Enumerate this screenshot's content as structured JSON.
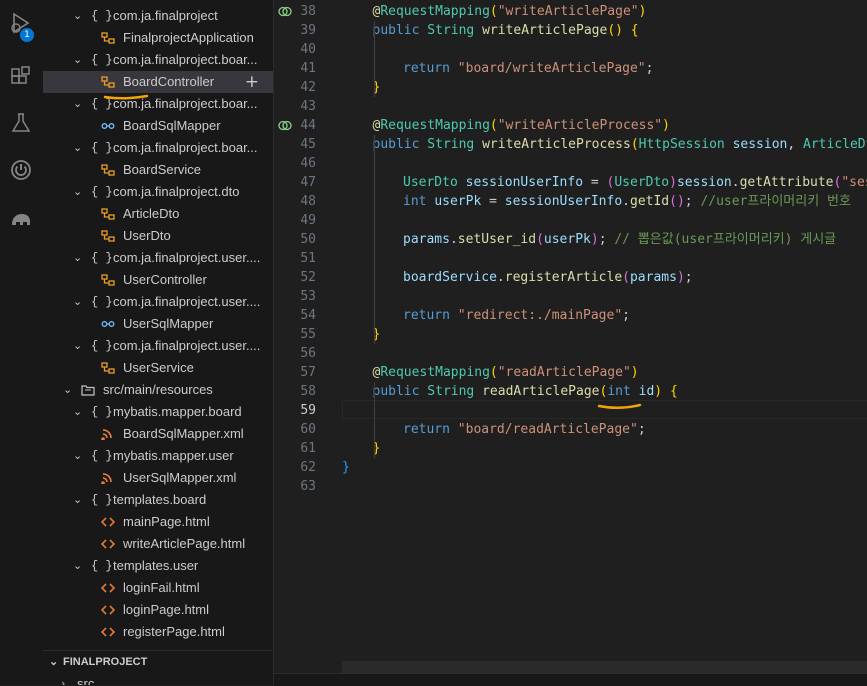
{
  "activity_bar": {
    "icons": [
      "run-debug-icon",
      "extensions-icon",
      "testing-icon",
      "spring-boot-icon",
      "gradle-elephant-icon"
    ],
    "debug_badge": "1"
  },
  "explorer": {
    "rows": [
      {
        "label": "com.ja.finalproject",
        "type": "package",
        "indent": 1
      },
      {
        "label": "FinalprojectApplication",
        "type": "class",
        "indent": 2
      },
      {
        "label": "com.ja.finalproject.boar...",
        "type": "package",
        "indent": 1
      },
      {
        "label": "BoardController",
        "type": "class",
        "indent": 2,
        "selected": true
      },
      {
        "label": "com.ja.finalproject.boar...",
        "type": "package",
        "indent": 1
      },
      {
        "label": "BoardSqlMapper",
        "type": "interface",
        "indent": 2
      },
      {
        "label": "com.ja.finalproject.boar...",
        "type": "package",
        "indent": 1
      },
      {
        "label": "BoardService",
        "type": "class",
        "indent": 2
      },
      {
        "label": "com.ja.finalproject.dto",
        "type": "package",
        "indent": 1
      },
      {
        "label": "ArticleDto",
        "type": "class",
        "indent": 2
      },
      {
        "label": "UserDto",
        "type": "class",
        "indent": 2
      },
      {
        "label": "com.ja.finalproject.user....",
        "type": "package",
        "indent": 1
      },
      {
        "label": "UserController",
        "type": "class",
        "indent": 2
      },
      {
        "label": "com.ja.finalproject.user....",
        "type": "package",
        "indent": 1
      },
      {
        "label": "UserSqlMapper",
        "type": "interface",
        "indent": 2
      },
      {
        "label": "com.ja.finalproject.user....",
        "type": "package",
        "indent": 1
      },
      {
        "label": "UserService",
        "type": "class",
        "indent": 2
      },
      {
        "label": "src/main/resources",
        "type": "folder",
        "indent": 0
      },
      {
        "label": "mybatis.mapper.board",
        "type": "package",
        "indent": 1
      },
      {
        "label": "BoardSqlMapper.xml",
        "type": "xml",
        "indent": 2
      },
      {
        "label": "mybatis.mapper.user",
        "type": "package",
        "indent": 1
      },
      {
        "label": "UserSqlMapper.xml",
        "type": "xml",
        "indent": 2
      },
      {
        "label": "templates.board",
        "type": "package",
        "indent": 1
      },
      {
        "label": "mainPage.html",
        "type": "html",
        "indent": 2
      },
      {
        "label": "writeArticlePage.html",
        "type": "html",
        "indent": 2
      },
      {
        "label": "templates.user",
        "type": "package",
        "indent": 1
      },
      {
        "label": "loginFail.html",
        "type": "html",
        "indent": 2
      },
      {
        "label": "loginPage.html",
        "type": "html",
        "indent": 2
      },
      {
        "label": "registerPage.html",
        "type": "html",
        "indent": 2
      }
    ],
    "outline_title": "FINALPROJECT",
    "outline_next": "src"
  },
  "editor": {
    "current_line": "59",
    "lines": [
      {
        "num": "38",
        "icon": true,
        "tokens": [
          [
            "ann",
            "@"
          ],
          [
            "ty",
            "RequestMapping"
          ],
          [
            "br0",
            "("
          ],
          [
            "str",
            "\"writeArticlePage\""
          ],
          [
            "br0",
            ")"
          ]
        ],
        "indent": 1
      },
      {
        "num": "39",
        "tokens": [
          [
            "kw",
            "public "
          ],
          [
            "ty",
            "String "
          ],
          [
            "fn",
            "writeArticlePage"
          ],
          [
            "br0",
            "() {"
          ]
        ],
        "indent": 1
      },
      {
        "num": "40",
        "tokens": [],
        "indent": 0
      },
      {
        "num": "41",
        "tokens": [
          [
            "kw",
            "return "
          ],
          [
            "str",
            "\"board/writeArticlePage\""
          ],
          [
            "plain",
            ";"
          ]
        ],
        "indent": 2
      },
      {
        "num": "42",
        "tokens": [
          [
            "br0",
            "}"
          ]
        ],
        "indent": 1
      },
      {
        "num": "43",
        "tokens": [],
        "indent": 0
      },
      {
        "num": "44",
        "icon": true,
        "tokens": [
          [
            "ann",
            "@"
          ],
          [
            "ty",
            "RequestMapping"
          ],
          [
            "br0",
            "("
          ],
          [
            "str",
            "\"writeArticleProcess\""
          ],
          [
            "br0",
            ")"
          ]
        ],
        "indent": 1
      },
      {
        "num": "45",
        "tokens": [
          [
            "kw",
            "public "
          ],
          [
            "ty",
            "String "
          ],
          [
            "fn",
            "writeArticleProcess"
          ],
          [
            "br0",
            "("
          ],
          [
            "ty",
            "HttpSession "
          ],
          [
            "var",
            "session"
          ],
          [
            "plain",
            ", "
          ],
          [
            "ty",
            "ArticleDto"
          ]
        ],
        "indent": 1
      },
      {
        "num": "46",
        "tokens": [],
        "indent": 0
      },
      {
        "num": "47",
        "tokens": [
          [
            "ty",
            "UserDto "
          ],
          [
            "var",
            "sessionUserInfo"
          ],
          [
            "plain",
            " = "
          ],
          [
            "br1",
            "("
          ],
          [
            "ty",
            "UserDto"
          ],
          [
            "br1",
            ")"
          ],
          [
            "var",
            "session"
          ],
          [
            "plain",
            "."
          ],
          [
            "fn",
            "getAttribute"
          ],
          [
            "br1",
            "("
          ],
          [
            "str",
            "\"ses"
          ]
        ],
        "indent": 2
      },
      {
        "num": "48",
        "tokens": [
          [
            "kw",
            "int "
          ],
          [
            "var",
            "userPk"
          ],
          [
            "plain",
            " = "
          ],
          [
            "var",
            "sessionUserInfo"
          ],
          [
            "plain",
            "."
          ],
          [
            "fn",
            "getId"
          ],
          [
            "br1",
            "()"
          ],
          [
            "plain",
            "; "
          ],
          [
            "cm",
            "//user프라이머리키 번호 "
          ]
        ],
        "indent": 2
      },
      {
        "num": "49",
        "tokens": [],
        "indent": 0
      },
      {
        "num": "50",
        "tokens": [
          [
            "var",
            "params"
          ],
          [
            "plain",
            "."
          ],
          [
            "fn",
            "setUser_id"
          ],
          [
            "br1",
            "("
          ],
          [
            "var",
            "userPk"
          ],
          [
            "br1",
            ")"
          ],
          [
            "plain",
            "; "
          ],
          [
            "cm",
            "// 뽑은값(user프라이머리키) 게시글 "
          ]
        ],
        "indent": 2
      },
      {
        "num": "51",
        "tokens": [],
        "indent": 0
      },
      {
        "num": "52",
        "tokens": [
          [
            "var",
            "boardService"
          ],
          [
            "plain",
            "."
          ],
          [
            "fn",
            "registerArticle"
          ],
          [
            "br1",
            "("
          ],
          [
            "var",
            "params"
          ],
          [
            "br1",
            ")"
          ],
          [
            "plain",
            ";"
          ]
        ],
        "indent": 2
      },
      {
        "num": "53",
        "tokens": [],
        "indent": 0
      },
      {
        "num": "54",
        "tokens": [
          [
            "kw",
            "return "
          ],
          [
            "str",
            "\"redirect:./mainPage\""
          ],
          [
            "plain",
            ";"
          ]
        ],
        "indent": 2
      },
      {
        "num": "55",
        "tokens": [
          [
            "br0",
            "}"
          ]
        ],
        "indent": 1
      },
      {
        "num": "56",
        "tokens": [],
        "indent": 0
      },
      {
        "num": "57",
        "tokens": [
          [
            "ann",
            "@"
          ],
          [
            "ty",
            "RequestMapping"
          ],
          [
            "br0",
            "("
          ],
          [
            "str",
            "\"readArticlePage\""
          ],
          [
            "br0",
            ")"
          ]
        ],
        "indent": 1
      },
      {
        "num": "58",
        "tokens": [
          [
            "kw",
            "public "
          ],
          [
            "ty",
            "String "
          ],
          [
            "fn",
            "readArticlePage"
          ],
          [
            "br0",
            "("
          ],
          [
            "kw",
            "int "
          ],
          [
            "var",
            "id"
          ],
          [
            "br0",
            ") {"
          ]
        ],
        "indent": 1
      },
      {
        "num": "59",
        "tokens": [],
        "indent": 0
      },
      {
        "num": "60",
        "tokens": [
          [
            "kw",
            "return "
          ],
          [
            "str",
            "\"board/readArticlePage\""
          ],
          [
            "plain",
            ";"
          ]
        ],
        "indent": 2
      },
      {
        "num": "61",
        "tokens": [
          [
            "br0",
            "}"
          ]
        ],
        "indent": 1
      },
      {
        "num": "62",
        "tokens": [
          [
            "br2",
            "}"
          ]
        ],
        "indent": 0
      },
      {
        "num": "63",
        "tokens": [],
        "indent": 0
      }
    ]
  },
  "colors": {
    "accent_underline": "#f0a30a",
    "badge": "#0078d4",
    "background": "#1f1f1f",
    "sidebar": "#181818"
  }
}
